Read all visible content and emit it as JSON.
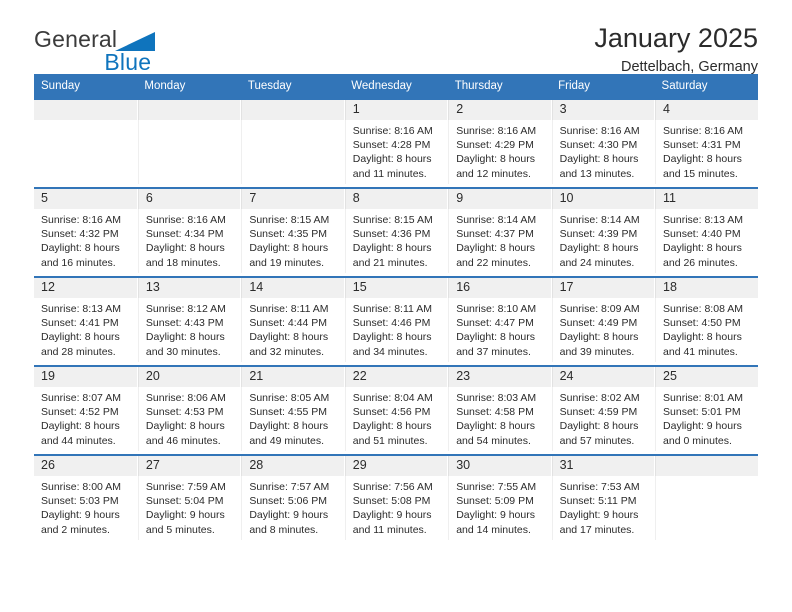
{
  "brand": {
    "name_part1": "General",
    "name_part2": "Blue",
    "triangle_color": "#0f74bd"
  },
  "header": {
    "title": "January 2025",
    "subtitle": "Dettelbach, Germany"
  },
  "colors": {
    "header_blue": "#3275b8",
    "daynum_band": "#f0f0f0",
    "text": "#2b2b2b"
  },
  "weekday_headers": [
    "Sunday",
    "Monday",
    "Tuesday",
    "Wednesday",
    "Thursday",
    "Friday",
    "Saturday"
  ],
  "weeks": [
    [
      {
        "day": "",
        "sunrise": "",
        "sunset": "",
        "daylight_line1": "",
        "daylight_line2": ""
      },
      {
        "day": "",
        "sunrise": "",
        "sunset": "",
        "daylight_line1": "",
        "daylight_line2": ""
      },
      {
        "day": "",
        "sunrise": "",
        "sunset": "",
        "daylight_line1": "",
        "daylight_line2": ""
      },
      {
        "day": "1",
        "sunrise": "Sunrise: 8:16 AM",
        "sunset": "Sunset: 4:28 PM",
        "daylight_line1": "Daylight: 8 hours",
        "daylight_line2": "and 11 minutes."
      },
      {
        "day": "2",
        "sunrise": "Sunrise: 8:16 AM",
        "sunset": "Sunset: 4:29 PM",
        "daylight_line1": "Daylight: 8 hours",
        "daylight_line2": "and 12 minutes."
      },
      {
        "day": "3",
        "sunrise": "Sunrise: 8:16 AM",
        "sunset": "Sunset: 4:30 PM",
        "daylight_line1": "Daylight: 8 hours",
        "daylight_line2": "and 13 minutes."
      },
      {
        "day": "4",
        "sunrise": "Sunrise: 8:16 AM",
        "sunset": "Sunset: 4:31 PM",
        "daylight_line1": "Daylight: 8 hours",
        "daylight_line2": "and 15 minutes."
      }
    ],
    [
      {
        "day": "5",
        "sunrise": "Sunrise: 8:16 AM",
        "sunset": "Sunset: 4:32 PM",
        "daylight_line1": "Daylight: 8 hours",
        "daylight_line2": "and 16 minutes."
      },
      {
        "day": "6",
        "sunrise": "Sunrise: 8:16 AM",
        "sunset": "Sunset: 4:34 PM",
        "daylight_line1": "Daylight: 8 hours",
        "daylight_line2": "and 18 minutes."
      },
      {
        "day": "7",
        "sunrise": "Sunrise: 8:15 AM",
        "sunset": "Sunset: 4:35 PM",
        "daylight_line1": "Daylight: 8 hours",
        "daylight_line2": "and 19 minutes."
      },
      {
        "day": "8",
        "sunrise": "Sunrise: 8:15 AM",
        "sunset": "Sunset: 4:36 PM",
        "daylight_line1": "Daylight: 8 hours",
        "daylight_line2": "and 21 minutes."
      },
      {
        "day": "9",
        "sunrise": "Sunrise: 8:14 AM",
        "sunset": "Sunset: 4:37 PM",
        "daylight_line1": "Daylight: 8 hours",
        "daylight_line2": "and 22 minutes."
      },
      {
        "day": "10",
        "sunrise": "Sunrise: 8:14 AM",
        "sunset": "Sunset: 4:39 PM",
        "daylight_line1": "Daylight: 8 hours",
        "daylight_line2": "and 24 minutes."
      },
      {
        "day": "11",
        "sunrise": "Sunrise: 8:13 AM",
        "sunset": "Sunset: 4:40 PM",
        "daylight_line1": "Daylight: 8 hours",
        "daylight_line2": "and 26 minutes."
      }
    ],
    [
      {
        "day": "12",
        "sunrise": "Sunrise: 8:13 AM",
        "sunset": "Sunset: 4:41 PM",
        "daylight_line1": "Daylight: 8 hours",
        "daylight_line2": "and 28 minutes."
      },
      {
        "day": "13",
        "sunrise": "Sunrise: 8:12 AM",
        "sunset": "Sunset: 4:43 PM",
        "daylight_line1": "Daylight: 8 hours",
        "daylight_line2": "and 30 minutes."
      },
      {
        "day": "14",
        "sunrise": "Sunrise: 8:11 AM",
        "sunset": "Sunset: 4:44 PM",
        "daylight_line1": "Daylight: 8 hours",
        "daylight_line2": "and 32 minutes."
      },
      {
        "day": "15",
        "sunrise": "Sunrise: 8:11 AM",
        "sunset": "Sunset: 4:46 PM",
        "daylight_line1": "Daylight: 8 hours",
        "daylight_line2": "and 34 minutes."
      },
      {
        "day": "16",
        "sunrise": "Sunrise: 8:10 AM",
        "sunset": "Sunset: 4:47 PM",
        "daylight_line1": "Daylight: 8 hours",
        "daylight_line2": "and 37 minutes."
      },
      {
        "day": "17",
        "sunrise": "Sunrise: 8:09 AM",
        "sunset": "Sunset: 4:49 PM",
        "daylight_line1": "Daylight: 8 hours",
        "daylight_line2": "and 39 minutes."
      },
      {
        "day": "18",
        "sunrise": "Sunrise: 8:08 AM",
        "sunset": "Sunset: 4:50 PM",
        "daylight_line1": "Daylight: 8 hours",
        "daylight_line2": "and 41 minutes."
      }
    ],
    [
      {
        "day": "19",
        "sunrise": "Sunrise: 8:07 AM",
        "sunset": "Sunset: 4:52 PM",
        "daylight_line1": "Daylight: 8 hours",
        "daylight_line2": "and 44 minutes."
      },
      {
        "day": "20",
        "sunrise": "Sunrise: 8:06 AM",
        "sunset": "Sunset: 4:53 PM",
        "daylight_line1": "Daylight: 8 hours",
        "daylight_line2": "and 46 minutes."
      },
      {
        "day": "21",
        "sunrise": "Sunrise: 8:05 AM",
        "sunset": "Sunset: 4:55 PM",
        "daylight_line1": "Daylight: 8 hours",
        "daylight_line2": "and 49 minutes."
      },
      {
        "day": "22",
        "sunrise": "Sunrise: 8:04 AM",
        "sunset": "Sunset: 4:56 PM",
        "daylight_line1": "Daylight: 8 hours",
        "daylight_line2": "and 51 minutes."
      },
      {
        "day": "23",
        "sunrise": "Sunrise: 8:03 AM",
        "sunset": "Sunset: 4:58 PM",
        "daylight_line1": "Daylight: 8 hours",
        "daylight_line2": "and 54 minutes."
      },
      {
        "day": "24",
        "sunrise": "Sunrise: 8:02 AM",
        "sunset": "Sunset: 4:59 PM",
        "daylight_line1": "Daylight: 8 hours",
        "daylight_line2": "and 57 minutes."
      },
      {
        "day": "25",
        "sunrise": "Sunrise: 8:01 AM",
        "sunset": "Sunset: 5:01 PM",
        "daylight_line1": "Daylight: 9 hours",
        "daylight_line2": "and 0 minutes."
      }
    ],
    [
      {
        "day": "26",
        "sunrise": "Sunrise: 8:00 AM",
        "sunset": "Sunset: 5:03 PM",
        "daylight_line1": "Daylight: 9 hours",
        "daylight_line2": "and 2 minutes."
      },
      {
        "day": "27",
        "sunrise": "Sunrise: 7:59 AM",
        "sunset": "Sunset: 5:04 PM",
        "daylight_line1": "Daylight: 9 hours",
        "daylight_line2": "and 5 minutes."
      },
      {
        "day": "28",
        "sunrise": "Sunrise: 7:57 AM",
        "sunset": "Sunset: 5:06 PM",
        "daylight_line1": "Daylight: 9 hours",
        "daylight_line2": "and 8 minutes."
      },
      {
        "day": "29",
        "sunrise": "Sunrise: 7:56 AM",
        "sunset": "Sunset: 5:08 PM",
        "daylight_line1": "Daylight: 9 hours",
        "daylight_line2": "and 11 minutes."
      },
      {
        "day": "30",
        "sunrise": "Sunrise: 7:55 AM",
        "sunset": "Sunset: 5:09 PM",
        "daylight_line1": "Daylight: 9 hours",
        "daylight_line2": "and 14 minutes."
      },
      {
        "day": "31",
        "sunrise": "Sunrise: 7:53 AM",
        "sunset": "Sunset: 5:11 PM",
        "daylight_line1": "Daylight: 9 hours",
        "daylight_line2": "and 17 minutes."
      },
      {
        "day": "",
        "sunrise": "",
        "sunset": "",
        "daylight_line1": "",
        "daylight_line2": ""
      }
    ]
  ]
}
